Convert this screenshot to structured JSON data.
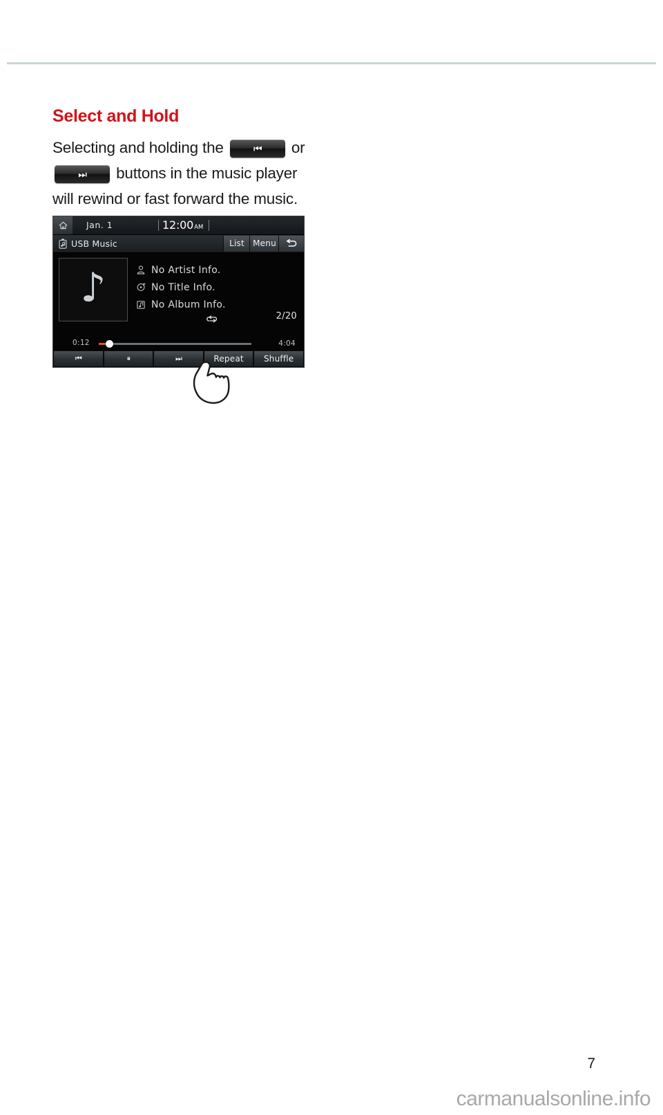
{
  "page": {
    "number": "7",
    "watermark": "carmanualsonline.info"
  },
  "section": {
    "heading": "Select and Hold",
    "paragraph_lines": [
      "Selecting and holding the",
      "or",
      "buttons in the music player",
      "will rewind or fast forward the music."
    ],
    "inline_buttons": [
      {
        "name": "rewind-button",
        "glyph": "⏮"
      },
      {
        "name": "fast-forward-button",
        "glyph": "⏭"
      }
    ]
  },
  "head_unit": {
    "status_bar": {
      "home_icon": "home-icon",
      "date": "Jan.  1",
      "time": "12:00",
      "meridiem": "AM"
    },
    "title_bar": {
      "source_icon": "usb-music-icon",
      "source_label": "USB Music",
      "list_label": "List",
      "menu_label": "Menu",
      "back_icon": "back-arrow-icon"
    },
    "media": {
      "album_art_icon": "music-note-icon",
      "album_art_glyph": "♪",
      "rows": [
        {
          "icon": "artist-icon",
          "text": "No Artist Info."
        },
        {
          "icon": "title-icon",
          "text": "No Title Info."
        },
        {
          "icon": "album-icon",
          "text": "No Album Info."
        }
      ],
      "repeat_icon": "repeat-icon",
      "track_count": "2/20"
    },
    "progress": {
      "current_time": "0:12",
      "total_time": "4:04",
      "percent": 6,
      "fill_color": "#e8511d"
    },
    "controls": [
      {
        "name": "previous-track-button",
        "glyph": "⏮",
        "label": ""
      },
      {
        "name": "pause-button",
        "glyph": "⏸",
        "label": ""
      },
      {
        "name": "next-track-button",
        "glyph": "⏭",
        "label": ""
      },
      {
        "name": "repeat-button",
        "glyph": "",
        "label": "Repeat"
      },
      {
        "name": "shuffle-button",
        "glyph": "",
        "label": "Shuffle"
      }
    ]
  },
  "colors": {
    "accent_red": "#d2121a",
    "rule": "#ccd6d6",
    "progress": "#e8511d"
  }
}
